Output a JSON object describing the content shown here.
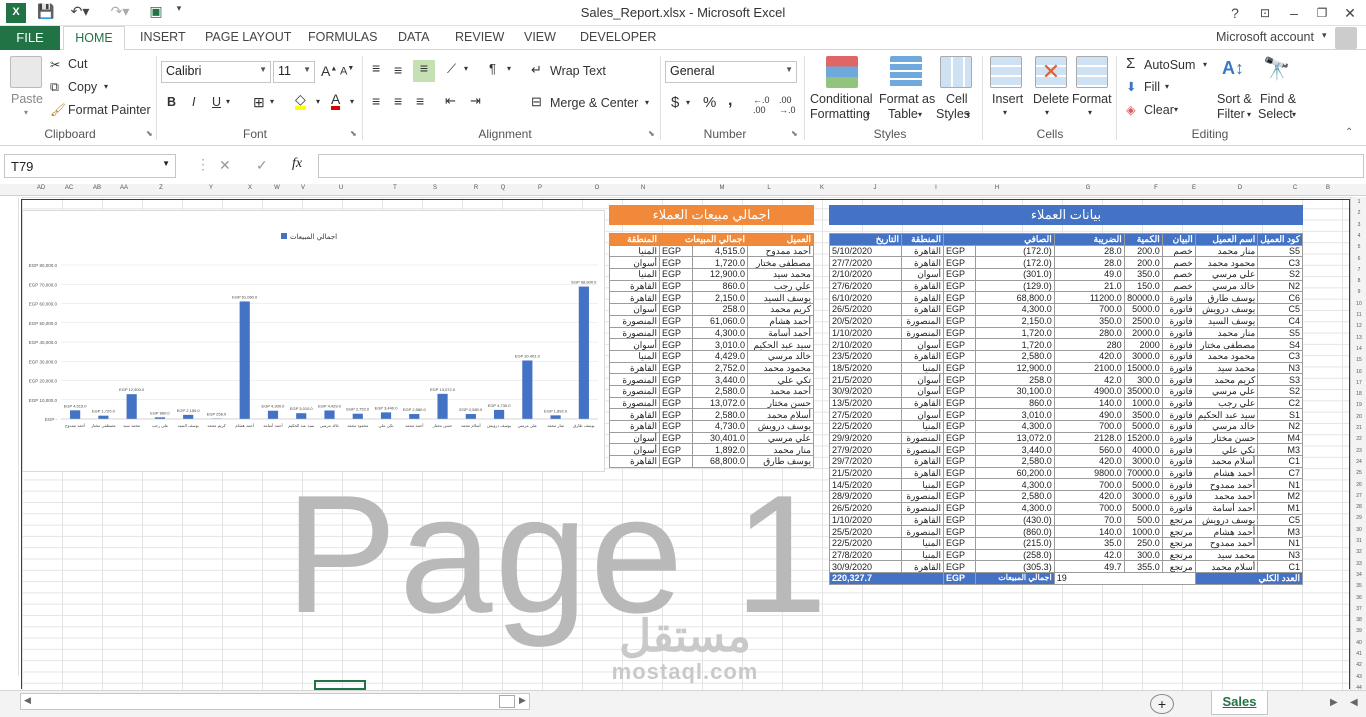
{
  "window": {
    "title": "Sales_Report.xlsx - Microsoft Excel",
    "help": "?",
    "account": "Microsoft account"
  },
  "tabs": {
    "file": "FILE",
    "home": "HOME",
    "others": [
      "INSERT",
      "PAGE LAYOUT",
      "FORMULAS",
      "DATA",
      "REVIEW",
      "VIEW",
      "DEVELOPER"
    ]
  },
  "ribbon": {
    "clipboard": {
      "paste": "Paste",
      "cut": "Cut",
      "copy": "Copy",
      "format_painter": "Format Painter",
      "label": "Clipboard"
    },
    "font": {
      "name": "Calibri",
      "size": "11",
      "bold": "B",
      "italic": "I",
      "underline": "U",
      "label": "Font"
    },
    "alignment": {
      "wrap": "Wrap Text",
      "merge": "Merge & Center",
      "label": "Alignment"
    },
    "number": {
      "format": "General",
      "currency": "$",
      "percent": "%",
      "comma": ",",
      "label": "Number"
    },
    "styles": {
      "cond": "Conditional",
      "cond2": "Formatting",
      "fmt_table": "Format as",
      "fmt_table2": "Table",
      "cell_styles": "Cell",
      "cell_styles2": "Styles",
      "label": "Styles"
    },
    "cells": {
      "insert": "Insert",
      "delete": "Delete",
      "format": "Format",
      "label": "Cells"
    },
    "editing": {
      "autosum": "AutoSum",
      "fill": "Fill",
      "clear": "Clear",
      "sort": "Sort &",
      "sort2": "Filter",
      "find": "Find &",
      "find2": "Select",
      "label": "Editing"
    }
  },
  "formula_bar": {
    "namebox": "T79",
    "fx": "fx",
    "cancel": "✕",
    "enter": "✓"
  },
  "columns": [
    "AD",
    "AC",
    "AB",
    "AA",
    "Z",
    "Y",
    "X",
    "W",
    "V",
    "U",
    "T",
    "S",
    "R",
    "Q",
    "P",
    "O",
    "N",
    "M",
    "L",
    "K",
    "J",
    "I",
    "H",
    "G",
    "F",
    "E",
    "D",
    "C",
    "B",
    "A"
  ],
  "customers": {
    "title": "بيانات العملاء",
    "headers": [
      "التاريخ",
      "المنطقة",
      "الصافي",
      "الضريبة",
      "الكمية",
      "البيان",
      "اسم العميل",
      "كود العميل"
    ],
    "rows": [
      [
        "5/10/2020",
        "القاهرة",
        "EGP",
        "(172.0)",
        "28.0",
        "200.0",
        "خصم",
        "منار محمد",
        "S5"
      ],
      [
        "27/7/2020",
        "القاهرة",
        "EGP",
        "(172.0)",
        "28.0",
        "200.0",
        "خصم",
        "محمود محمد",
        "C3"
      ],
      [
        "2/10/2020",
        "أسوان",
        "EGP",
        "(301.0)",
        "49.0",
        "350.0",
        "خصم",
        "علي مرسي",
        "S2"
      ],
      [
        "27/6/2020",
        "القاهرة",
        "EGP",
        "(129.0)",
        "21.0",
        "150.0",
        "خصم",
        "خالد مرسي",
        "N2"
      ],
      [
        "6/10/2020",
        "القاهرة",
        "EGP",
        "68,800.0",
        "11200.0",
        "80000.0",
        "فاتورة",
        "يوسف طارق",
        "C6"
      ],
      [
        "26/5/2020",
        "القاهرة",
        "EGP",
        "4,300.0",
        "700.0",
        "5000.0",
        "فاتورة",
        "يوسف درويش",
        "C5"
      ],
      [
        "20/5/2020",
        "المنصورة",
        "EGP",
        "2,150.0",
        "350.0",
        "2500.0",
        "فاتورة",
        "يوسف السيد",
        "C4"
      ],
      [
        "1/10/2020",
        "المنصورة",
        "EGP",
        "1,720.0",
        "280.0",
        "2000.0",
        "فاتورة",
        "منار محمد",
        "S5"
      ],
      [
        "2/10/2020",
        "أسوان",
        "EGP",
        "1,720.0",
        "280",
        "2000",
        "فاتورة",
        "مصطفى مختار",
        "S4"
      ],
      [
        "23/5/2020",
        "القاهرة",
        "EGP",
        "2,580.0",
        "420.0",
        "3000.0",
        "فاتورة",
        "محمود محمد",
        "C3"
      ],
      [
        "18/5/2020",
        "المنيا",
        "EGP",
        "12,900.0",
        "2100.0",
        "15000.0",
        "فاتورة",
        "محمد سيد",
        "N3"
      ],
      [
        "21/5/2020",
        "أسوان",
        "EGP",
        "258.0",
        "42.0",
        "300.0",
        "فاتورة",
        "كريم محمد",
        "S3"
      ],
      [
        "30/9/2020",
        "أسوان",
        "EGP",
        "30,100.0",
        "4900.0",
        "35000.0",
        "فاتورة",
        "علي مرسي",
        "S2"
      ],
      [
        "13/5/2020",
        "القاهرة",
        "EGP",
        "860.0",
        "140.0",
        "1000.0",
        "فاتورة",
        "علي رجب",
        "C2"
      ],
      [
        "27/5/2020",
        "أسوان",
        "EGP",
        "3,010.0",
        "490.0",
        "3500.0",
        "فاتورة",
        "سيد عبد الحكيم",
        "S1"
      ],
      [
        "22/5/2020",
        "المنيا",
        "EGP",
        "4,300.0",
        "700.0",
        "5000.0",
        "فاتورة",
        "خالد مرسي",
        "N2"
      ],
      [
        "29/9/2020",
        "المنصورة",
        "EGP",
        "13,072.0",
        "2128.0",
        "15200.0",
        "فاتورة",
        "حسن مختار",
        "M4"
      ],
      [
        "27/9/2020",
        "المنصورة",
        "EGP",
        "3,440.0",
        "560.0",
        "4000.0",
        "فاتورة",
        "تكي علي",
        "M3"
      ],
      [
        "29/7/2020",
        "القاهرة",
        "EGP",
        "2,580.0",
        "420.0",
        "3000.0",
        "فاتورة",
        "أسلام محمد",
        "C1"
      ],
      [
        "21/5/2020",
        "القاهرة",
        "EGP",
        "60,200.0",
        "9800.0",
        "70000.0",
        "فاتورة",
        "أحمد هشام",
        "C7"
      ],
      [
        "14/5/2020",
        "المنيا",
        "EGP",
        "4,300.0",
        "700.0",
        "5000.0",
        "فاتورة",
        "أحمد ممدوح",
        "N1"
      ],
      [
        "28/9/2020",
        "المنصورة",
        "EGP",
        "2,580.0",
        "420.0",
        "3000.0",
        "فاتورة",
        "أحمد محمد",
        "M2"
      ],
      [
        "26/5/2020",
        "المنصورة",
        "EGP",
        "4,300.0",
        "700.0",
        "5000.0",
        "فاتورة",
        "أحمد أسامة",
        "M1"
      ],
      [
        "1/10/2020",
        "القاهرة",
        "EGP",
        "(430.0)",
        "70.0",
        "500.0",
        "مرتجع",
        "يوسف درويش",
        "C5"
      ],
      [
        "25/5/2020",
        "المنصورة",
        "EGP",
        "(860.0)",
        "140.0",
        "1000.0",
        "مرتجع",
        "أحمد هشام",
        "M3"
      ],
      [
        "22/5/2020",
        "المنيا",
        "EGP",
        "(215.0)",
        "35.0",
        "250.0",
        "مرتجع",
        "أحمد ممدوح",
        "N1"
      ],
      [
        "27/8/2020",
        "المنيا",
        "EGP",
        "(258.0)",
        "42.0",
        "300.0",
        "مرتجع",
        "محمد سيد",
        "N3"
      ],
      [
        "30/9/2020",
        "القاهرة",
        "EGP",
        "(305.3)",
        "49.7",
        "355.0",
        "مرتجع",
        "أسلام محمد",
        "C1"
      ]
    ],
    "total_label": "اجمالي المبيعات",
    "total_currency": "EGP",
    "total_value": "220,327.7",
    "count_label": "العدد الكلي",
    "count_value": "19"
  },
  "sales": {
    "title": "اجمالي مبيعات العملاء",
    "headers": [
      "المنطقة",
      "اجمالي المبيعات",
      "العميل"
    ],
    "rows": [
      [
        "المنيا",
        "EGP",
        "4,515.0",
        "أحمد ممدوح"
      ],
      [
        "أسوان",
        "EGP",
        "1,720.0",
        "مصطفى مختار"
      ],
      [
        "المنيا",
        "EGP",
        "12,900.0",
        "محمد سيد"
      ],
      [
        "القاهرة",
        "EGP",
        "860.0",
        "علي رجب"
      ],
      [
        "القاهرة",
        "EGP",
        "2,150.0",
        "يوسف السيد"
      ],
      [
        "أسوان",
        "EGP",
        "258.0",
        "كريم محمد"
      ],
      [
        "المنصورة",
        "EGP",
        "61,060.0",
        "أحمد هشام"
      ],
      [
        "المنصورة",
        "EGP",
        "4,300.0",
        "أحمد أسامة"
      ],
      [
        "أسوان",
        "EGP",
        "3,010.0",
        "سيد عبد الحكيم"
      ],
      [
        "المنيا",
        "EGP",
        "4,429.0",
        "خالد مرسي"
      ],
      [
        "القاهرة",
        "EGP",
        "2,752.0",
        "محمود محمد"
      ],
      [
        "المنصورة",
        "EGP",
        "3,440.0",
        "تكي علي"
      ],
      [
        "المنصورة",
        "EGP",
        "2,580.0",
        "أحمد محمد"
      ],
      [
        "المنصورة",
        "EGP",
        "13,072.0",
        "حسن مختار"
      ],
      [
        "القاهرة",
        "EGP",
        "2,580.0",
        "أسلام محمد"
      ],
      [
        "القاهرة",
        "EGP",
        "4,730.0",
        "يوسف درويش"
      ],
      [
        "أسوان",
        "EGP",
        "30,401.0",
        "علي مرسي"
      ],
      [
        "أسوان",
        "EGP",
        "1,892.0",
        "منار محمد"
      ],
      [
        "القاهرة",
        "EGP",
        "68,800.0",
        "يوسف طارق"
      ]
    ]
  },
  "chart_data": {
    "type": "bar",
    "title": "",
    "legend": "اجمالي المبيعات",
    "legend_position": "top",
    "categories": [
      "أحمد ممدوح",
      "مصطفى مختار",
      "محمد سيد",
      "علي رجب",
      "يوسف السيد",
      "كريم محمد",
      "أحمد هشام",
      "أحمد أسامة",
      "سيد عبد الحكيم",
      "خالد مرسي",
      "محمود محمد",
      "تكي علي",
      "أحمد محمد",
      "حسن مختار",
      "أسلام محمد",
      "يوسف درويش",
      "علي مرسي",
      "منار محمد",
      "يوسف طارق"
    ],
    "values": [
      4515,
      1720,
      12900,
      860,
      2150,
      258,
      61060,
      4300,
      3010,
      4429,
      2752,
      3440,
      2580,
      13072,
      2580,
      4730,
      30401,
      1892,
      68800
    ],
    "labels": [
      "EGP 4,515.0",
      "EGP 1,720.0",
      "EGP 12,900.0",
      "EGP 860.0",
      "EGP 2,150.0",
      "EGP 258.0",
      "EGP 61,060.0",
      "EGP 4,300.0",
      "EGP 3,010.0",
      "EGP 4,429.0",
      "EGP 2,752.0",
      "EGP 3,440.0",
      "EGP 2,580.0",
      "EGP 13,072.0",
      "EGP 2,580.0",
      "EGP 4,730.0",
      "EGP 30,401.0",
      "EGP 1,892.0",
      "EGP 68,800.0"
    ],
    "yticks": [
      "EGP -",
      "EGP 10,000.0",
      "EGP 20,000.0",
      "EGP 30,000.0",
      "EGP 40,000.0",
      "EGP 50,000.0",
      "EGP 60,000.0",
      "EGP 70,000.0",
      "EGP 80,000.0"
    ],
    "ylim": [
      0,
      80000
    ],
    "color": "#4472c4"
  },
  "watermarks": {
    "page": "Page 1",
    "mostaql_ar": "مستقل",
    "mostaql_en": "mostaql.com"
  },
  "sheet_tabs": {
    "active": "Sales",
    "add": "+"
  }
}
